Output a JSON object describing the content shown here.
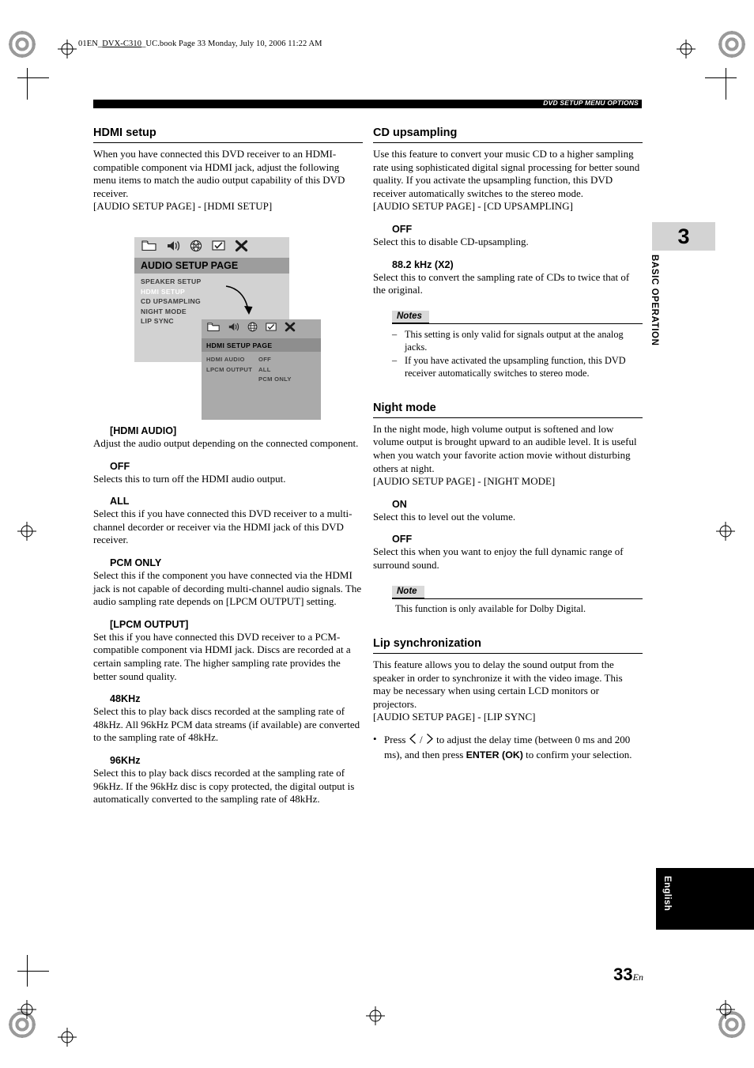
{
  "header": {
    "file_line_prefix": "01EN_",
    "file_line_underlined": "DVX-C310",
    "file_line_rest": "_UC.book  Page 33  Monday, July 10, 2006  11:22 AM",
    "chapter_bar_label": "DVD SETUP MENU OPTIONS"
  },
  "left": {
    "hdmi_setup": {
      "heading": "HDMI setup",
      "intro": "When you have connected this DVD receiver to an HDMI-compatible component via HDMI jack, adjust the following menu items to match the audio output capability of this DVD receiver.",
      "path": "[AUDIO SETUP PAGE] - [HDMI SETUP]"
    },
    "osd": {
      "title": "AUDIO SETUP PAGE",
      "items": [
        "SPEAKER SETUP",
        "HDMI SETUP",
        "CD UPSAMPLING",
        "NIGHT MODE",
        "LIP SYNC"
      ],
      "highlighted_index": 1,
      "sub_title": "HDMI SETUP PAGE",
      "sub_rows": [
        {
          "key": "HDMI AUDIO",
          "value": "OFF"
        },
        {
          "key": "LPCM OUTPUT",
          "value": "ALL"
        },
        {
          "key": "",
          "value": "PCM ONLY"
        }
      ]
    },
    "sections": [
      {
        "title": "[HDMI AUDIO]",
        "body": "Adjust the audio output depending on the connected component.",
        "options": [
          {
            "label": "OFF",
            "text": "Selects this to turn off the HDMI audio output."
          },
          {
            "label": "ALL",
            "text": "Select this if you have connected this DVD receiver to a multi-channel decorder or receiver via the HDMI jack of this DVD receiver."
          },
          {
            "label": "PCM ONLY",
            "text": "Select this if the component you have connected via the HDMI jack is not capable of decording multi-channel audio signals. The audio sampling rate depends on [LPCM OUTPUT] setting."
          }
        ]
      },
      {
        "title": "[LPCM OUTPUT]",
        "body": "Set this if you have connected this DVD receiver to a PCM-compatible component via HDMI jack. Discs are recorded at a certain sampling rate. The higher sampling rate provides the better sound quality.",
        "options": [
          {
            "label": "48KHz",
            "text": "Select this to play back discs recorded at the sampling rate of 48kHz. All 96kHz PCM data streams (if available) are converted to the sampling rate of 48kHz."
          },
          {
            "label": "96KHz",
            "text": "Select this to play back discs recorded at the sampling rate of 96kHz. If the 96kHz disc is copy protected, the digital output is automatically converted to the sampling rate of 48kHz."
          }
        ]
      }
    ]
  },
  "right": {
    "cd_upsampling": {
      "heading": "CD upsampling",
      "intro": "Use this feature to convert your music CD to a higher sampling rate using sophisticated digital signal processing for better sound quality. If you activate the upsampling function, this DVD receiver automatically switches to the stereo mode.",
      "path": "[AUDIO SETUP PAGE] - [CD UPSAMPLING]",
      "options": [
        {
          "label": "OFF",
          "text": "Select this to disable CD-upsampling."
        },
        {
          "label": "88.2 kHz (X2)",
          "text": "Select this to convert the sampling rate of CDs to twice that of the original."
        }
      ],
      "notes_label": "Notes",
      "notes": [
        "This setting is only valid for signals output at the analog jacks.",
        "If you have activated the upsampling function, this DVD receiver automatically switches to stereo mode."
      ]
    },
    "night_mode": {
      "heading": "Night mode",
      "intro": "In the night mode, high volume output is softened and low volume output is brought upward to an audible level. It is useful when you watch your favorite action movie without disturbing others at night.",
      "path": "[AUDIO SETUP PAGE] - [NIGHT MODE]",
      "options": [
        {
          "label": "ON",
          "text": "Select this to level out the volume."
        },
        {
          "label": "OFF",
          "text": "Select this when you want to enjoy the full dynamic range of surround sound."
        }
      ],
      "note_label": "Note",
      "note": "This function is only available for Dolby Digital."
    },
    "lip_sync": {
      "heading": "Lip synchronization",
      "intro": "This feature allows you to delay the sound output from the speaker in order to synchronize it with the video image. This may be necessary when using certain LCD monitors or projectors.",
      "path": "[AUDIO SETUP PAGE] - [LIP SYNC]",
      "bullet_pre": "Press",
      "bullet_mid": "/",
      "bullet_post": "to adjust the delay time (between 0 ms and 200 ms), and then press",
      "bullet_bold": "ENTER (OK)",
      "bullet_end": "to confirm your selection."
    }
  },
  "tabs": {
    "chapter_number": "3",
    "chapter_name": "BASIC OPERATION",
    "language": "English"
  },
  "footer": {
    "page_number": "33",
    "page_suffix": "En"
  }
}
